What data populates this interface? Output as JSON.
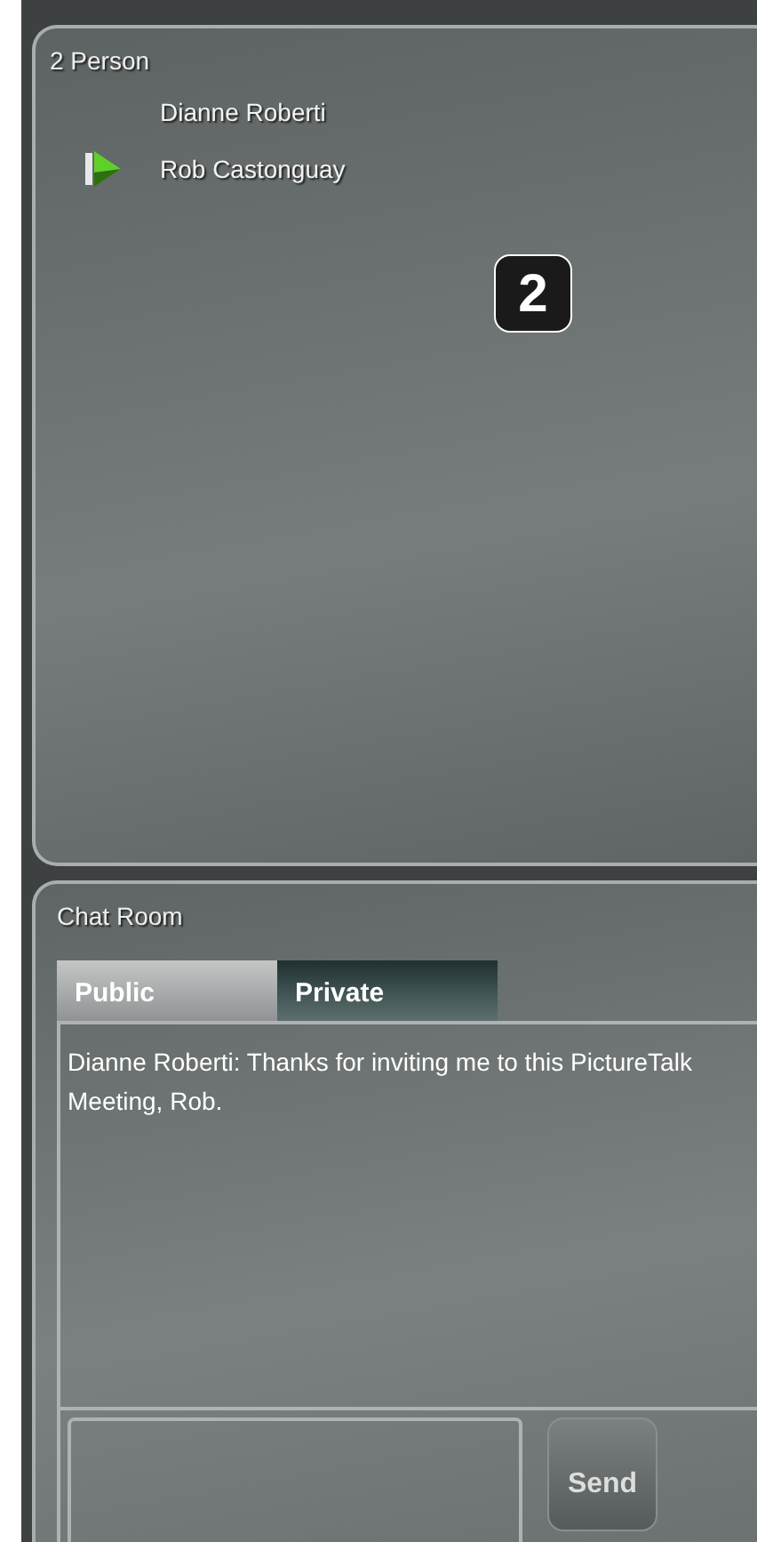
{
  "participants_panel": {
    "title": "2 Person",
    "participants": [
      {
        "name": "Dianne Roberti",
        "presenting": false
      },
      {
        "name": "Rob Castonguay",
        "presenting": true
      }
    ]
  },
  "callout": "2",
  "chat_room": {
    "title": "Chat Room",
    "tabs": [
      {
        "label": "Public",
        "selected": true
      },
      {
        "label": "Private",
        "selected": false
      }
    ],
    "messages": [
      "Dianne Roberti: Thanks for inviting me to this PictureTalk Meeting, Rob."
    ],
    "send_button": "Send"
  }
}
